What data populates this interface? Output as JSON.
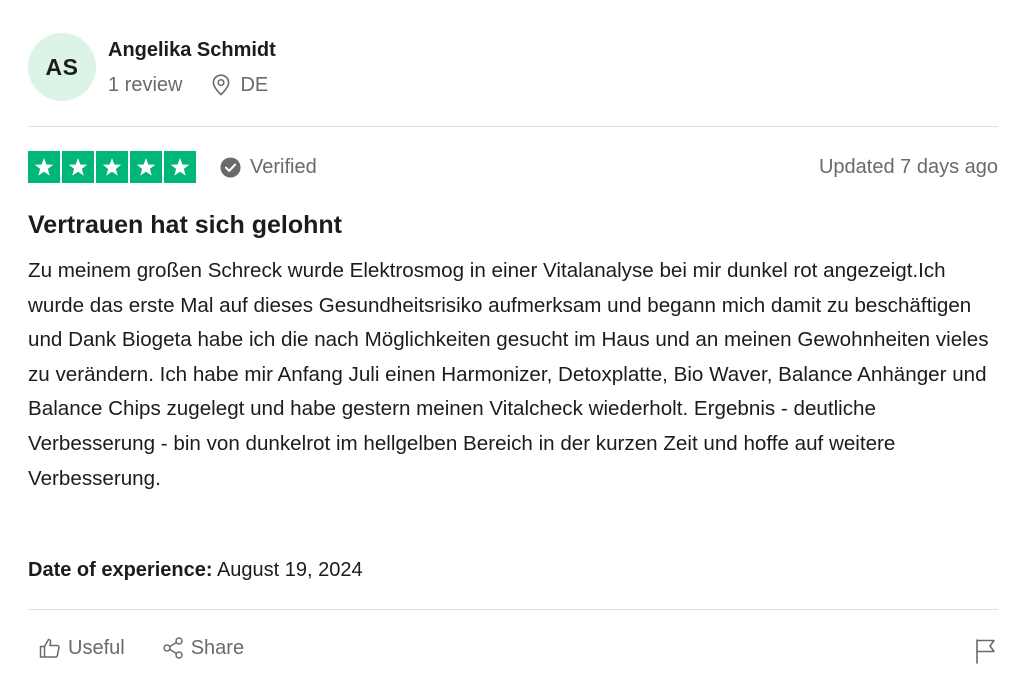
{
  "reviewer": {
    "initials": "AS",
    "name": "Angelika Schmidt",
    "review_count": "1 review",
    "country": "DE"
  },
  "rating": {
    "stars": 5,
    "max_stars": 5,
    "verified_label": "Verified",
    "updated": "Updated 7 days ago"
  },
  "review": {
    "title": "Vertrauen hat sich gelohnt",
    "body": "Zu meinem großen Schreck wurde Elektrosmog in einer Vitalanalyse bei mir dunkel rot angezeigt.Ich wurde das erste Mal auf dieses Gesundheitsrisiko aufmerksam und begann mich damit zu beschäftigen und Dank Biogeta habe ich die nach Möglichkeiten gesucht im Haus und an meinen Gewohnheiten vieles zu verändern. Ich habe mir Anfang Juli einen Harmonizer, Detoxplatte, Bio Waver, Balance Anhänger und Balance Chips zugelegt und habe gestern meinen Vitalcheck wiederholt. Ergebnis - deutliche Verbesserung - bin von dunkelrot im hellgelben Bereich in der kurzen Zeit und hoffe auf weitere Verbesserung.",
    "experience_label": "Date of experience:",
    "experience_date": "August 19, 2024"
  },
  "actions": {
    "useful_label": "Useful",
    "share_label": "Share"
  },
  "colors": {
    "star_green": "#00b67a",
    "avatar_bg": "#dbf4e6",
    "muted_text": "#6a6a6a"
  },
  "icons": [
    "location-pin-icon",
    "star-icon",
    "verified-check-icon",
    "thumbs-up-icon",
    "share-icon",
    "flag-icon"
  ]
}
